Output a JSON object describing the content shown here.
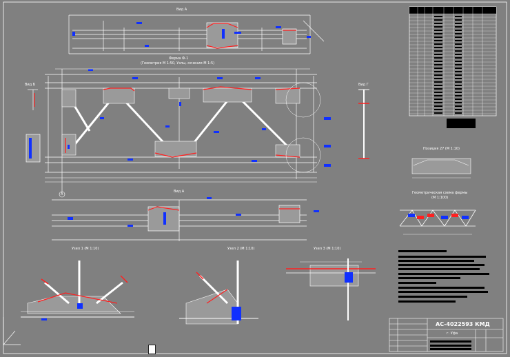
{
  "drawing": {
    "sheet_code": "АС-4022593 КМД",
    "sheet_sub": "г. Уфа",
    "views": {
      "view_a_top": "Вид А",
      "farm_title": "Ферма Ф-1",
      "farm_subtitle": "(Геометрия М 1:50, Узлы, сечения М 1:5)",
      "view_b_left": "Вид Б",
      "view_g_right": "Вид Г",
      "view_a_bottom": "Вид А",
      "section_27": "Позиция 27 (М 1:10)",
      "geometry_scheme": "Геометрическая схема фермы",
      "geometry_scale": "(М 1:100)",
      "node1": "Узел 1 (М 1:10)",
      "node2": "Узел 2 (М 1:10)",
      "node3": "Узел 3 (М 1:10)"
    },
    "axis_marker": "А"
  },
  "colors": {
    "background": "#808080",
    "line_white": "#ffffff",
    "line_red": "#ff2020",
    "line_blue": "#1030ff",
    "line_black": "#000000",
    "fill_gray": "#9a9a9a"
  }
}
